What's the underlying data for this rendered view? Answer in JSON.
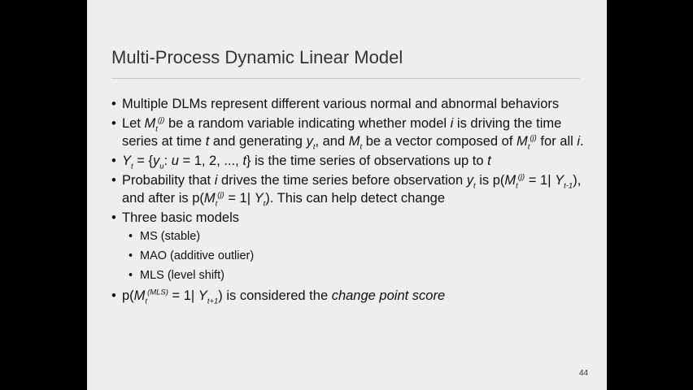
{
  "slide": {
    "title": "Multi-Process Dynamic Linear Model",
    "bullets": [
      {
        "text": "Multiple DLMs represent different various normal and abnormal behaviors"
      },
      {
        "p1": "Let ",
        "M": "M",
        "t": "t",
        "j": "(j)",
        "p2": " be a random variable indicating whether model ",
        "i": "i",
        "p3": " is driving the time series at time ",
        "t2": "t",
        "p4": " and generating ",
        "y": "y",
        "yt": "t",
        "p5": ", and ",
        "M2": "M",
        "t3": "t",
        "p6": " be a vector composed of ",
        "M3": "M",
        "t4": "t",
        "j2": "(j)",
        "p7": " for all ",
        "i2": "i",
        "p8": "."
      },
      {
        "Y": "Y",
        "t": "t",
        "p1": " = {",
        "y": "y",
        "u": "u",
        "p2": ": ",
        "u2": "u",
        "p3": " = 1, 2, ..., ",
        "t2": "t",
        "p4": "} is the time series of observations up to ",
        "t3": "t"
      },
      {
        "p1": "Probability that ",
        "i": "i",
        "p2": " drives the time series before observation ",
        "y": "y",
        "t": "t",
        "p3": " is p(",
        "M": "M",
        "t2": "t",
        "j": "(j)",
        "p4": " = 1| ",
        "Y": "Y",
        "tm1": "t-1",
        "p5": "), and after is p(",
        "M2": "M",
        "t3": "t",
        "j2": "(j)",
        "p6": " = 1| ",
        "Y2": "Y",
        "t4": "t",
        "p7": "). This can help detect change"
      },
      {
        "text": "Three basic models"
      },
      {
        "p1": "p(",
        "M": "M",
        "t": "t",
        "mls": "(MLS)",
        "p2": " = 1| ",
        "Y": "Y",
        "tp1": "t+1",
        "p3": ") is considered the ",
        "cps": "change point score"
      }
    ],
    "sub_bullets": [
      "MS (stable)",
      "MAO (additive outlier)",
      "MLS (level shift)"
    ],
    "page_number": "44"
  }
}
